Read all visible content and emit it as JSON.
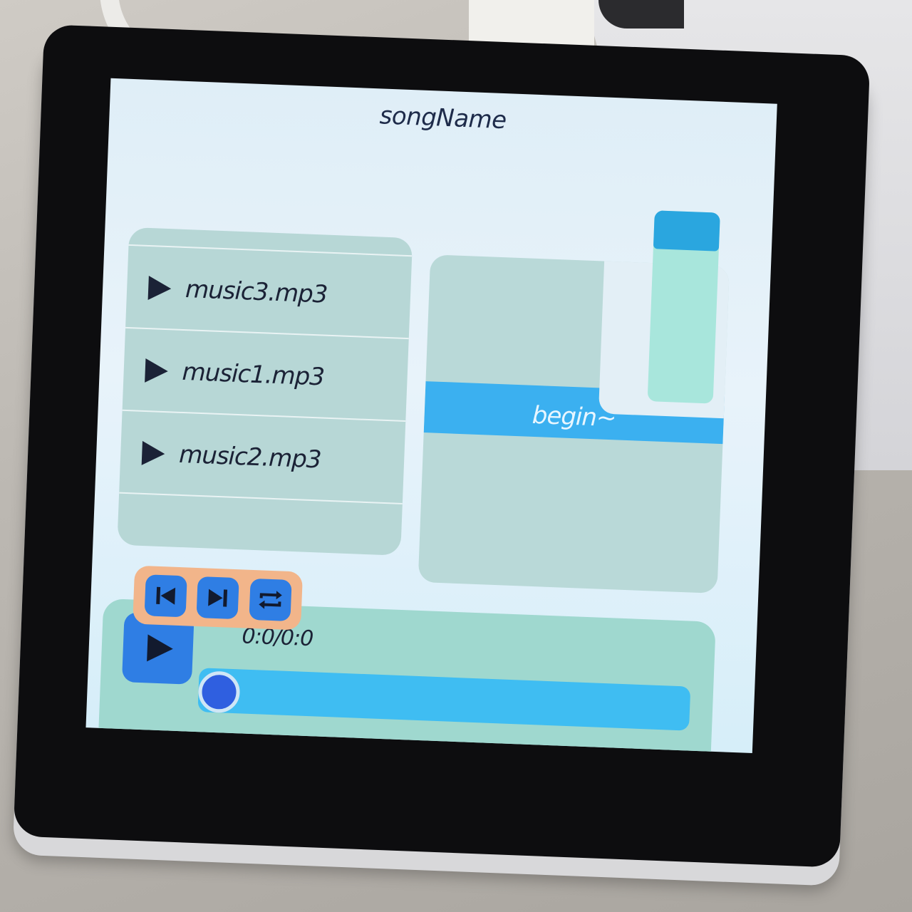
{
  "header": {
    "song_title": "songName"
  },
  "playlist": {
    "items": [
      {
        "label": "music3.mp3",
        "icon": "play-triangle-icon"
      },
      {
        "label": "music1.mp3",
        "icon": "play-triangle-icon"
      },
      {
        "label": "music2.mp3",
        "icon": "play-triangle-icon"
      }
    ]
  },
  "visualizer": {
    "status_text": "begin~"
  },
  "volume": {
    "level_fraction": 0.82
  },
  "controls": {
    "prev": {
      "icon": "skip-previous-icon"
    },
    "next": {
      "icon": "skip-next-icon"
    },
    "loop": {
      "icon": "repeat-icon"
    }
  },
  "player": {
    "play_icon": "play-icon",
    "time_text": "0:0/0:0",
    "progress_fraction": 0
  },
  "colors": {
    "button_blue": "#2f7ee4",
    "control_group": "#f2b58a",
    "progress_bar": "#3fbdf2",
    "status_band": "#3bb0f0",
    "text_dark": "#1b2236"
  }
}
